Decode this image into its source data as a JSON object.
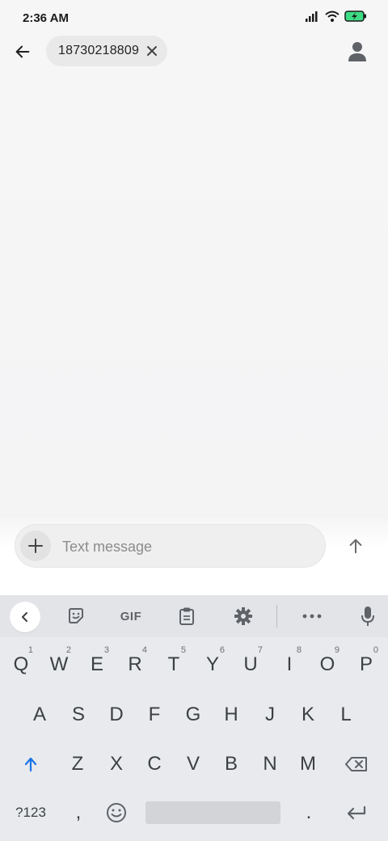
{
  "status_bar": {
    "time": "2:36 AM",
    "icons": [
      "signal-icon",
      "wifi-icon",
      "battery-charging-icon"
    ],
    "battery_color": "#3ddc84"
  },
  "header": {
    "back_icon": "arrow-left-icon",
    "recipient": "18730218809",
    "chip_remove_icon": "close-icon",
    "contact_icon": "person-icon"
  },
  "compose": {
    "attach_icon": "plus-icon",
    "placeholder": "Text message",
    "value": "",
    "send_icon": "arrow-up-icon"
  },
  "keyboard": {
    "toolbar": {
      "collapse_icon": "chevron-left-icon",
      "sticker_icon": "sticker-icon",
      "gif_label": "GIF",
      "clipboard_icon": "clipboard-icon",
      "settings_icon": "gear-icon",
      "more_icon": "more-horiz-icon",
      "mic_icon": "mic-icon"
    },
    "row1": [
      {
        "key": "Q",
        "hint": "1"
      },
      {
        "key": "W",
        "hint": "2"
      },
      {
        "key": "E",
        "hint": "3"
      },
      {
        "key": "R",
        "hint": "4"
      },
      {
        "key": "T",
        "hint": "5"
      },
      {
        "key": "Y",
        "hint": "6"
      },
      {
        "key": "U",
        "hint": "7"
      },
      {
        "key": "I",
        "hint": "8"
      },
      {
        "key": "O",
        "hint": "9"
      },
      {
        "key": "P",
        "hint": "0"
      }
    ],
    "row2": [
      "A",
      "S",
      "D",
      "F",
      "G",
      "H",
      "J",
      "K",
      "L"
    ],
    "row3": [
      "Z",
      "X",
      "C",
      "V",
      "B",
      "N",
      "M"
    ],
    "shift_icon": "shift-arrow-icon",
    "shift_color": "#1a73e8",
    "backspace_icon": "backspace-icon",
    "row4": {
      "symbols": "?123",
      "comma": ",",
      "emoji_icon": "emoji-icon",
      "period": ".",
      "enter_icon": "enter-return-icon"
    }
  }
}
